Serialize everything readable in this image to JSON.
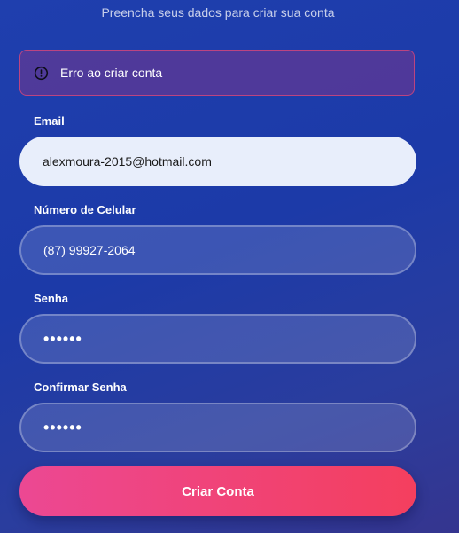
{
  "header": {
    "subtitle": "Preencha seus dados para criar sua conta"
  },
  "error": {
    "icon": "alert-circle-icon",
    "message": "Erro ao criar conta",
    "color": "#e24878"
  },
  "form": {
    "email": {
      "label": "Email",
      "value": "alexmoura-2015@hotmail.com"
    },
    "phone": {
      "label": "Número de Celular",
      "value": "(87) 99927-2064"
    },
    "password": {
      "label": "Senha",
      "value": "••••••"
    },
    "confirm_password": {
      "label": "Confirmar Senha",
      "value": "••••••"
    },
    "submit_label": "Criar Conta"
  },
  "colors": {
    "background": "#1f3fae",
    "button_start": "#ec4893",
    "button_end": "#f43f5e",
    "input_active": "#e8eefb"
  }
}
